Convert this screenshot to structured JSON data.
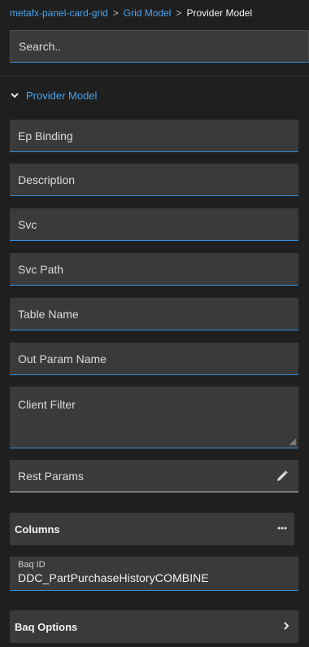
{
  "breadcrumb": {
    "items": [
      "metafx-panel-card-grid",
      "Grid Model"
    ],
    "separator": ">",
    "current": "Provider Model"
  },
  "search": {
    "placeholder": "Search.."
  },
  "section": {
    "title": "Provider Model",
    "icon": "chevron-down-icon"
  },
  "fields": {
    "ep_binding": "Ep Binding",
    "description": "Description",
    "svc": "Svc",
    "svc_path": "Svc Path",
    "table_name": "Table Name",
    "out_param_name": "Out Param Name",
    "client_filter": "Client Filter",
    "rest_params": "Rest Params"
  },
  "columns_card": {
    "label": "Columns",
    "icon": "more-horizontal-icon"
  },
  "baq_id": {
    "label": "Baq ID",
    "value": "DDC_PartPurchaseHistoryCOMBINE"
  },
  "baq_options_card": {
    "label": "Baq Options",
    "icon": "chevron-right-icon"
  },
  "colors": {
    "background": "#1f1f1f",
    "field_background": "#3a3a3a",
    "accent": "#2f8fe0",
    "link": "#4aa3f0"
  }
}
